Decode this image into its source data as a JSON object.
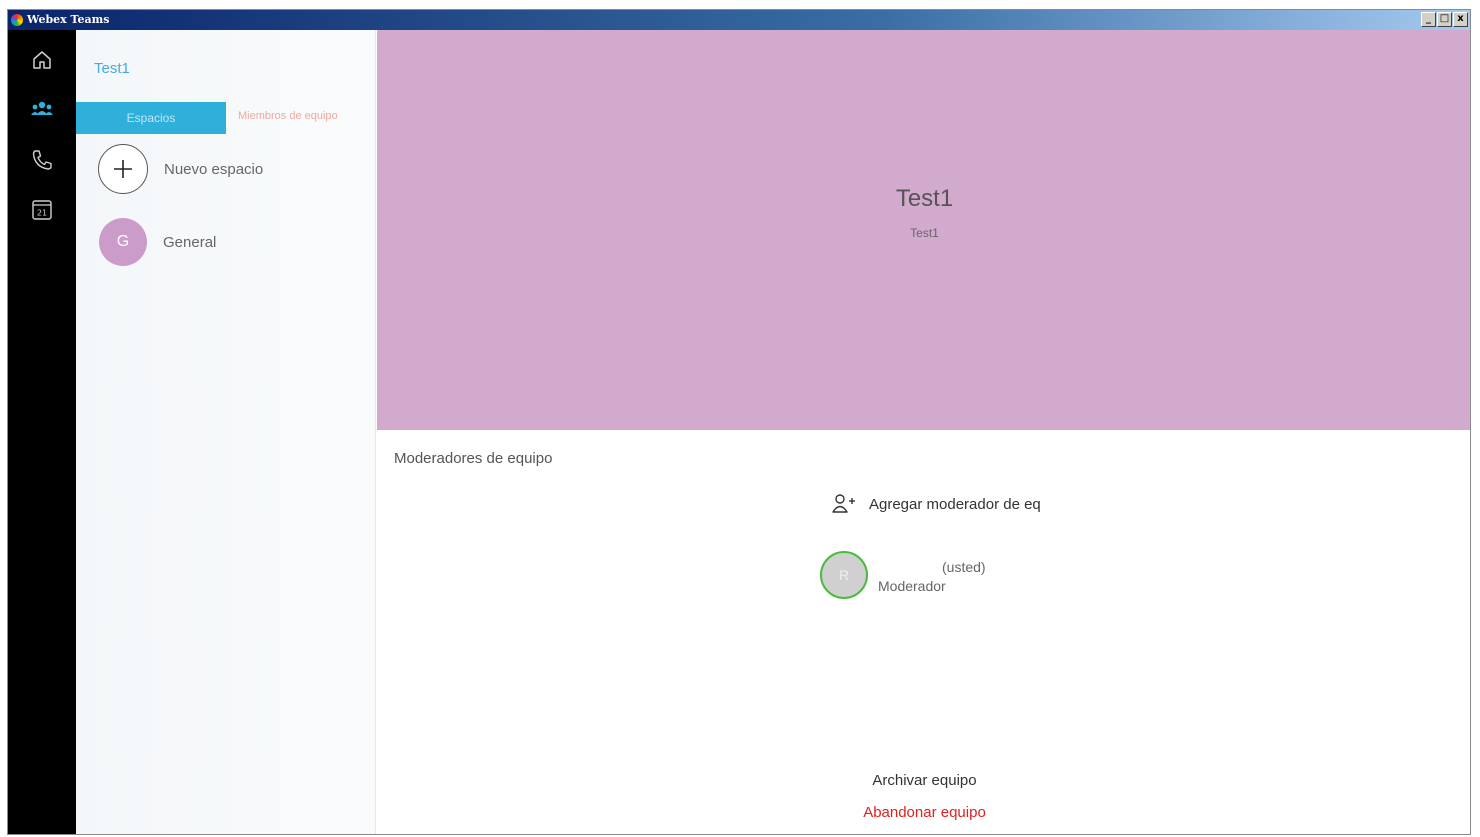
{
  "window": {
    "title": "Webex Teams",
    "controls": {
      "minimize": "_",
      "maximize": "□",
      "close": "x"
    }
  },
  "nav_rail": {
    "items": [
      {
        "icon": "home-icon"
      },
      {
        "icon": "teams-icon",
        "active": true
      },
      {
        "icon": "phone-icon"
      },
      {
        "icon": "calendar-icon",
        "label": "21"
      }
    ],
    "active_color": "#2fb0da"
  },
  "team_panel": {
    "team_name": "Test1",
    "tabs": [
      {
        "label": "Espacios",
        "active": true
      },
      {
        "label": "Miembros de equipo",
        "active": false
      }
    ],
    "spaces": [
      {
        "label": "Nuevo espacio",
        "icon": "plus-icon"
      },
      {
        "label": "General",
        "avatar": "G",
        "avatar_color": "#cb9bc9"
      }
    ]
  },
  "main": {
    "banner": {
      "title": "Test1",
      "subtitle": "Test1",
      "color": "#d2aacd"
    },
    "moderators": {
      "section_title": "Moderadores de equipo",
      "add_label": "Agregar moderador de eq",
      "list": [
        {
          "avatar": "R",
          "you_label": "(usted)",
          "role": "Moderador",
          "status_color": "#4cbb3f"
        }
      ]
    },
    "actions": {
      "archive": "Archivar equipo",
      "leave": "Abandonar equipo"
    }
  }
}
